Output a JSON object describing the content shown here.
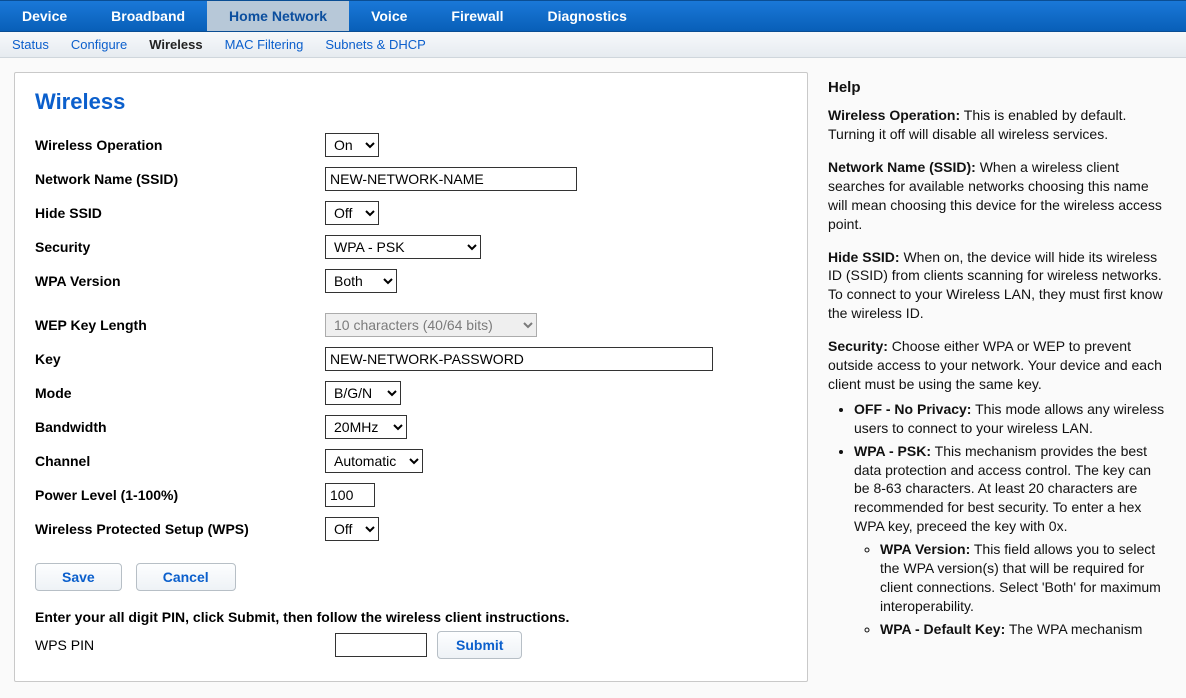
{
  "nav": {
    "primary": [
      "Device",
      "Broadband",
      "Home Network",
      "Voice",
      "Firewall",
      "Diagnostics"
    ],
    "primary_active": "Home Network",
    "secondary": [
      "Status",
      "Configure",
      "Wireless",
      "MAC Filtering",
      "Subnets & DHCP"
    ],
    "secondary_active": "Wireless"
  },
  "page": {
    "title": "Wireless",
    "fields": {
      "wireless_operation": {
        "label": "Wireless Operation",
        "value": "On"
      },
      "ssid": {
        "label": "Network Name (SSID)",
        "value": "NEW-NETWORK-NAME"
      },
      "hide_ssid": {
        "label": "Hide SSID",
        "value": "Off"
      },
      "security": {
        "label": "Security",
        "value": "WPA - PSK"
      },
      "wpa_version": {
        "label": "WPA Version",
        "value": "Both"
      },
      "wep_key_length": {
        "label": "WEP Key Length",
        "value": "10 characters (40/64 bits)"
      },
      "key": {
        "label": "Key",
        "value": "NEW-NETWORK-PASSWORD"
      },
      "mode": {
        "label": "Mode",
        "value": "B/G/N"
      },
      "bandwidth": {
        "label": "Bandwidth",
        "value": "20MHz"
      },
      "channel": {
        "label": "Channel",
        "value": "Automatic"
      },
      "power_level": {
        "label": "Power Level (1-100%)",
        "value": "100"
      },
      "wps": {
        "label": "Wireless Protected Setup (WPS)",
        "value": "Off"
      }
    },
    "buttons": {
      "save": "Save",
      "cancel": "Cancel",
      "submit": "Submit"
    },
    "wps_instruction": "Enter your all digit PIN, click Submit, then follow the wireless client instructions.",
    "wps_pin_label": "WPS PIN",
    "wps_pin_value": ""
  },
  "help": {
    "title": "Help",
    "p1a": "Wireless Operation:",
    "p1b": " This is enabled by default. Turning it off will disable all wireless services.",
    "p2a": "Network Name (SSID):",
    "p2b": " When a wireless client searches for available networks choosing this name will mean choosing this device for the wireless access point.",
    "p3a": "Hide SSID:",
    "p3b": " When on, the device will hide its wireless ID (SSID) from clients scanning for wireless networks. To connect to your Wireless LAN, they must first know the wireless ID.",
    "p4a": "Security:",
    "p4b": " Choose either WPA or WEP to prevent outside access to your network. Your device and each client must be using the same key.",
    "li1a": "OFF - No Privacy:",
    "li1b": " This mode allows any wireless users to connect to your wireless LAN.",
    "li2a": "WPA - PSK:",
    "li2b": " This mechanism provides the best data protection and access control. The key can be 8-63 characters. At least 20 characters are recommended for best security. To enter a hex WPA key, preceed the key with 0x.",
    "li2_1a": "WPA Version:",
    "li2_1b": " This field allows you to select the WPA version(s) that will be required for client connections. Select 'Both' for maximum interoperability.",
    "li2_2a": "WPA - Default Key:",
    "li2_2b": " The WPA mechanism"
  }
}
